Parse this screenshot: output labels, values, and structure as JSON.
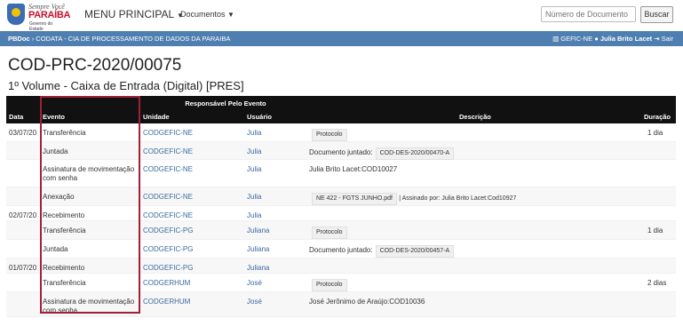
{
  "header": {
    "logo_line1": "Sempre Você",
    "logo_line2": "PARAÍBA",
    "logo_line3": "Governo do Estado",
    "menu_main": "MENU PRINCIPAL",
    "menu_docs": "Documentos",
    "search_placeholder": "Número de Documento",
    "search_button": "Buscar"
  },
  "nav": {
    "crumb_root": "PBDoc",
    "crumb_sep": "›",
    "crumb_org": "CODATA - CIA DE PROCESSAMENTO DE DADOS DA PARAIBA",
    "unit": "GEFIC-NE",
    "user": "Julia Brito Lacet",
    "logout": "Sair"
  },
  "document": {
    "code": "COD-PRC-2020/00075",
    "subtitle": "1º Volume - Caixa de Entrada (Digital) [PRES]"
  },
  "table": {
    "group_header": "Responsável Pelo Evento",
    "columns": {
      "data": "Data",
      "evento": "Evento",
      "unidade": "Unidade",
      "usuario": "Usuário",
      "descricao": "Descrição",
      "duracao": "Duração"
    },
    "rows": [
      {
        "data": "03/07/20",
        "evento": "Transferência",
        "unidade": "CODGEFIC-NE",
        "usuario": "Julia",
        "desc_text": "",
        "desc_tag": "Protocolo",
        "duracao": "1 dia"
      },
      {
        "data": "",
        "evento": "Juntada",
        "unidade": "CODGEFIC-NE",
        "usuario": "Julia",
        "desc_text": "Documento juntado:",
        "desc_tag": "COD-DES-2020/00470-A",
        "duracao": ""
      },
      {
        "data": "",
        "evento": "Assinatura de movimentação com senha",
        "unidade": "CODGEFIC-NE",
        "usuario": "Julia",
        "desc_text": "Julia Brito Lacet:COD10027",
        "desc_tag": "",
        "duracao": ""
      },
      {
        "data": "",
        "evento": "Anexação",
        "unidade": "CODGEFIC-NE",
        "usuario": "Julia",
        "desc_text": "| Assinado por: Julia Brito Lacet:Cod10927",
        "desc_tag": "NE 422 - FGTS JUNHO.pdf",
        "duracao": ""
      },
      {
        "data": "02/07/20",
        "evento": "Recebimento",
        "unidade": "CODGEFIC-NE",
        "usuario": "Julia",
        "desc_text": "",
        "desc_tag": "",
        "duracao": ""
      },
      {
        "data": "",
        "evento": "Transferência",
        "unidade": "CODGEFIC-PG",
        "usuario": "Juliana",
        "desc_text": "",
        "desc_tag": "Protocolo",
        "duracao": "1 dia"
      },
      {
        "data": "",
        "evento": "Juntada",
        "unidade": "CODGEFIC-PG",
        "usuario": "Juliana",
        "desc_text": "Documento juntado:",
        "desc_tag": "COD-DES-2020/00457-A",
        "duracao": ""
      },
      {
        "data": "01/07/20",
        "evento": "Recebimento",
        "unidade": "CODGEFIC-PG",
        "usuario": "Juliana",
        "desc_text": "",
        "desc_tag": "",
        "duracao": ""
      },
      {
        "data": "",
        "evento": "Transferência",
        "unidade": "CODGERHUM",
        "usuario": "José",
        "desc_text": "",
        "desc_tag": "Protocolo",
        "duracao": "2 dias"
      },
      {
        "data": "",
        "evento": "Assinatura de movimentação com senha",
        "unidade": "CODGERHUM",
        "usuario": "José",
        "desc_text": "José Jerônimo de Araújo:COD10036",
        "desc_tag": "",
        "duracao": ""
      }
    ]
  },
  "colors": {
    "blue_bar": "#4f7fb0",
    "table_header": "#111111",
    "highlight_border": "#a0203a",
    "link": "#3b6aa0"
  }
}
